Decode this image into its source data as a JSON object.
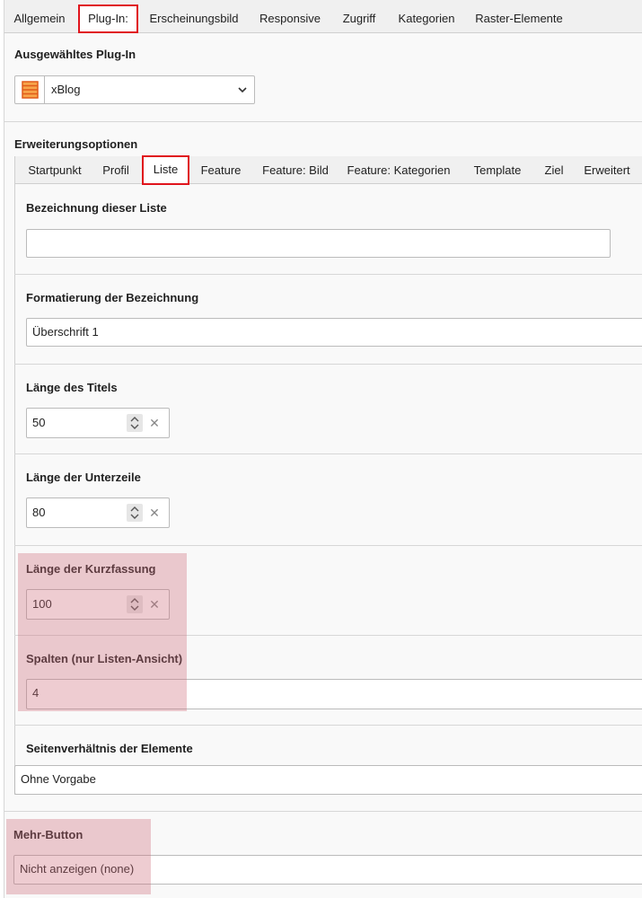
{
  "tabs": [
    {
      "label": "Allgemein"
    },
    {
      "label": "Plug-In:"
    },
    {
      "label": "Erscheinungsbild"
    },
    {
      "label": "Responsive"
    },
    {
      "label": "Zugriff"
    },
    {
      "label": "Kategorien"
    },
    {
      "label": "Raster-Elemente"
    }
  ],
  "plugin": {
    "label": "Ausgewähltes Plug-In",
    "value": "xBlog"
  },
  "extension": {
    "label": "Erweiterungsoptionen",
    "tabs": [
      {
        "label": "Startpunkt"
      },
      {
        "label": "Profil"
      },
      {
        "label": "Liste"
      },
      {
        "label": "Feature"
      },
      {
        "label": "Feature: Bild"
      },
      {
        "label": "Feature: Kategorien"
      },
      {
        "label": "Template"
      },
      {
        "label": "Ziel"
      },
      {
        "label": "Erweitert"
      }
    ]
  },
  "fields": {
    "list_name": {
      "label": "Bezeichnung dieser Liste",
      "value": ""
    },
    "format": {
      "label": "Formatierung der Bezeichnung",
      "value": "Überschrift 1"
    },
    "title_length": {
      "label": "Länge des Titels",
      "value": "50"
    },
    "subline_length": {
      "label": "Länge der Unterzeile",
      "value": "80"
    },
    "summary_length": {
      "label": "Länge der Kurzfassung",
      "value": "100"
    },
    "columns": {
      "label": "Spalten (nur Listen-Ansicht)",
      "value": "4"
    },
    "aspect_ratio": {
      "label": "Seitenverhältnis der Elemente",
      "value": "Ohne Vorgabe"
    },
    "more_button": {
      "label": "Mehr-Button",
      "value": "Nicht anzeigen (none)"
    }
  },
  "colors": {
    "active_tab_border": "#e0141c",
    "highlight": "#ce6e7c"
  }
}
